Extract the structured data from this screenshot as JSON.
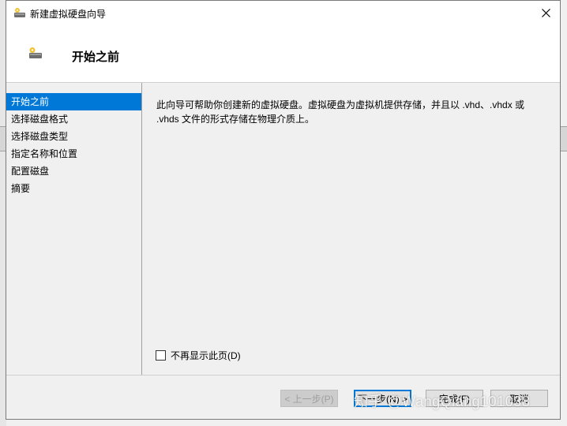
{
  "window": {
    "title": "新建虚拟硬盘向导",
    "close_glyph": "✕",
    "icon": "virtual-disk-icon"
  },
  "header": {
    "title": "开始之前",
    "icon": "virtual-disk-icon"
  },
  "nav": {
    "items": [
      {
        "label": "开始之前",
        "selected": true
      },
      {
        "label": "选择磁盘格式",
        "selected": false
      },
      {
        "label": "选择磁盘类型",
        "selected": false
      },
      {
        "label": "指定名称和位置",
        "selected": false
      },
      {
        "label": "配置磁盘",
        "selected": false
      },
      {
        "label": "摘要",
        "selected": false
      }
    ]
  },
  "content": {
    "description": "此向导可帮助你创建新的虚拟硬盘。虚拟硬盘为虚拟机提供存储，并且以 .vhd、.vhdx 或 .vhds 文件的形式存储在物理介质上。"
  },
  "options": {
    "dont_show_label": "不再显示此页(D)",
    "dont_show_checked": false
  },
  "buttons": {
    "prev": "< 上一步(P)",
    "next": "下一步(N) >",
    "finish": "完成(F)",
    "cancel": "取消"
  },
  "watermark": "知乎 @WangQiang101038",
  "colors": {
    "accent": "#0078d7",
    "background": "#f0f0f0"
  }
}
